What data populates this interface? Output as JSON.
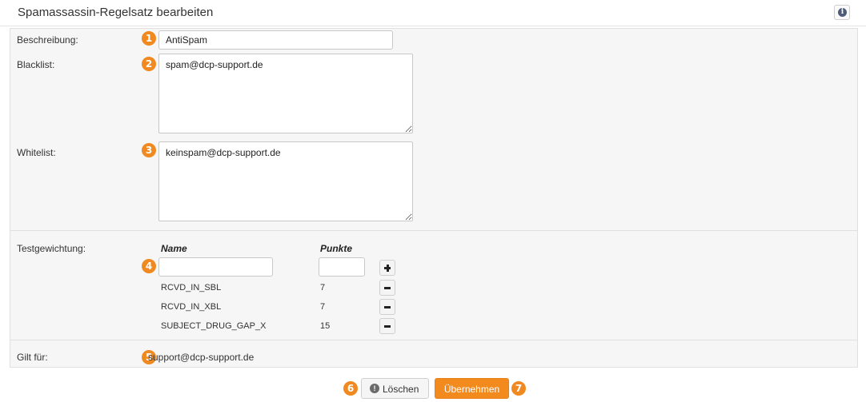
{
  "header": {
    "title": "Spamassassin-Regelsatz bearbeiten",
    "info_icon": "i"
  },
  "form": {
    "description": {
      "label": "Beschreibung:",
      "value": "AntiSpam",
      "badge": "1"
    },
    "blacklist": {
      "label": "Blacklist:",
      "value": "spam@dcp-support.de",
      "badge": "2"
    },
    "whitelist": {
      "label": "Whitelist:",
      "value": "keinspam@dcp-support.de",
      "badge": "3"
    },
    "test_weighting": {
      "label": "Testgewichtung:",
      "badge": "4",
      "col_name": "Name",
      "col_points": "Punkte",
      "new_name": "",
      "new_points": "",
      "rules": [
        {
          "name": "RCVD_IN_SBL",
          "points": "7"
        },
        {
          "name": "RCVD_IN_XBL",
          "points": "7"
        },
        {
          "name": "SUBJECT_DRUG_GAP_X",
          "points": "15"
        }
      ]
    },
    "applies_to": {
      "label": "Gilt für:",
      "value": "support@dcp-support.de",
      "badge": "5"
    }
  },
  "actions": {
    "delete_label": "Löschen",
    "delete_badge": "6",
    "delete_icon": "!",
    "apply_label": "Übernehmen",
    "apply_badge": "7"
  },
  "colors": {
    "accent": "#f28a1e",
    "panel_bg": "#f6f6f6",
    "border": "#e0e0e0"
  }
}
